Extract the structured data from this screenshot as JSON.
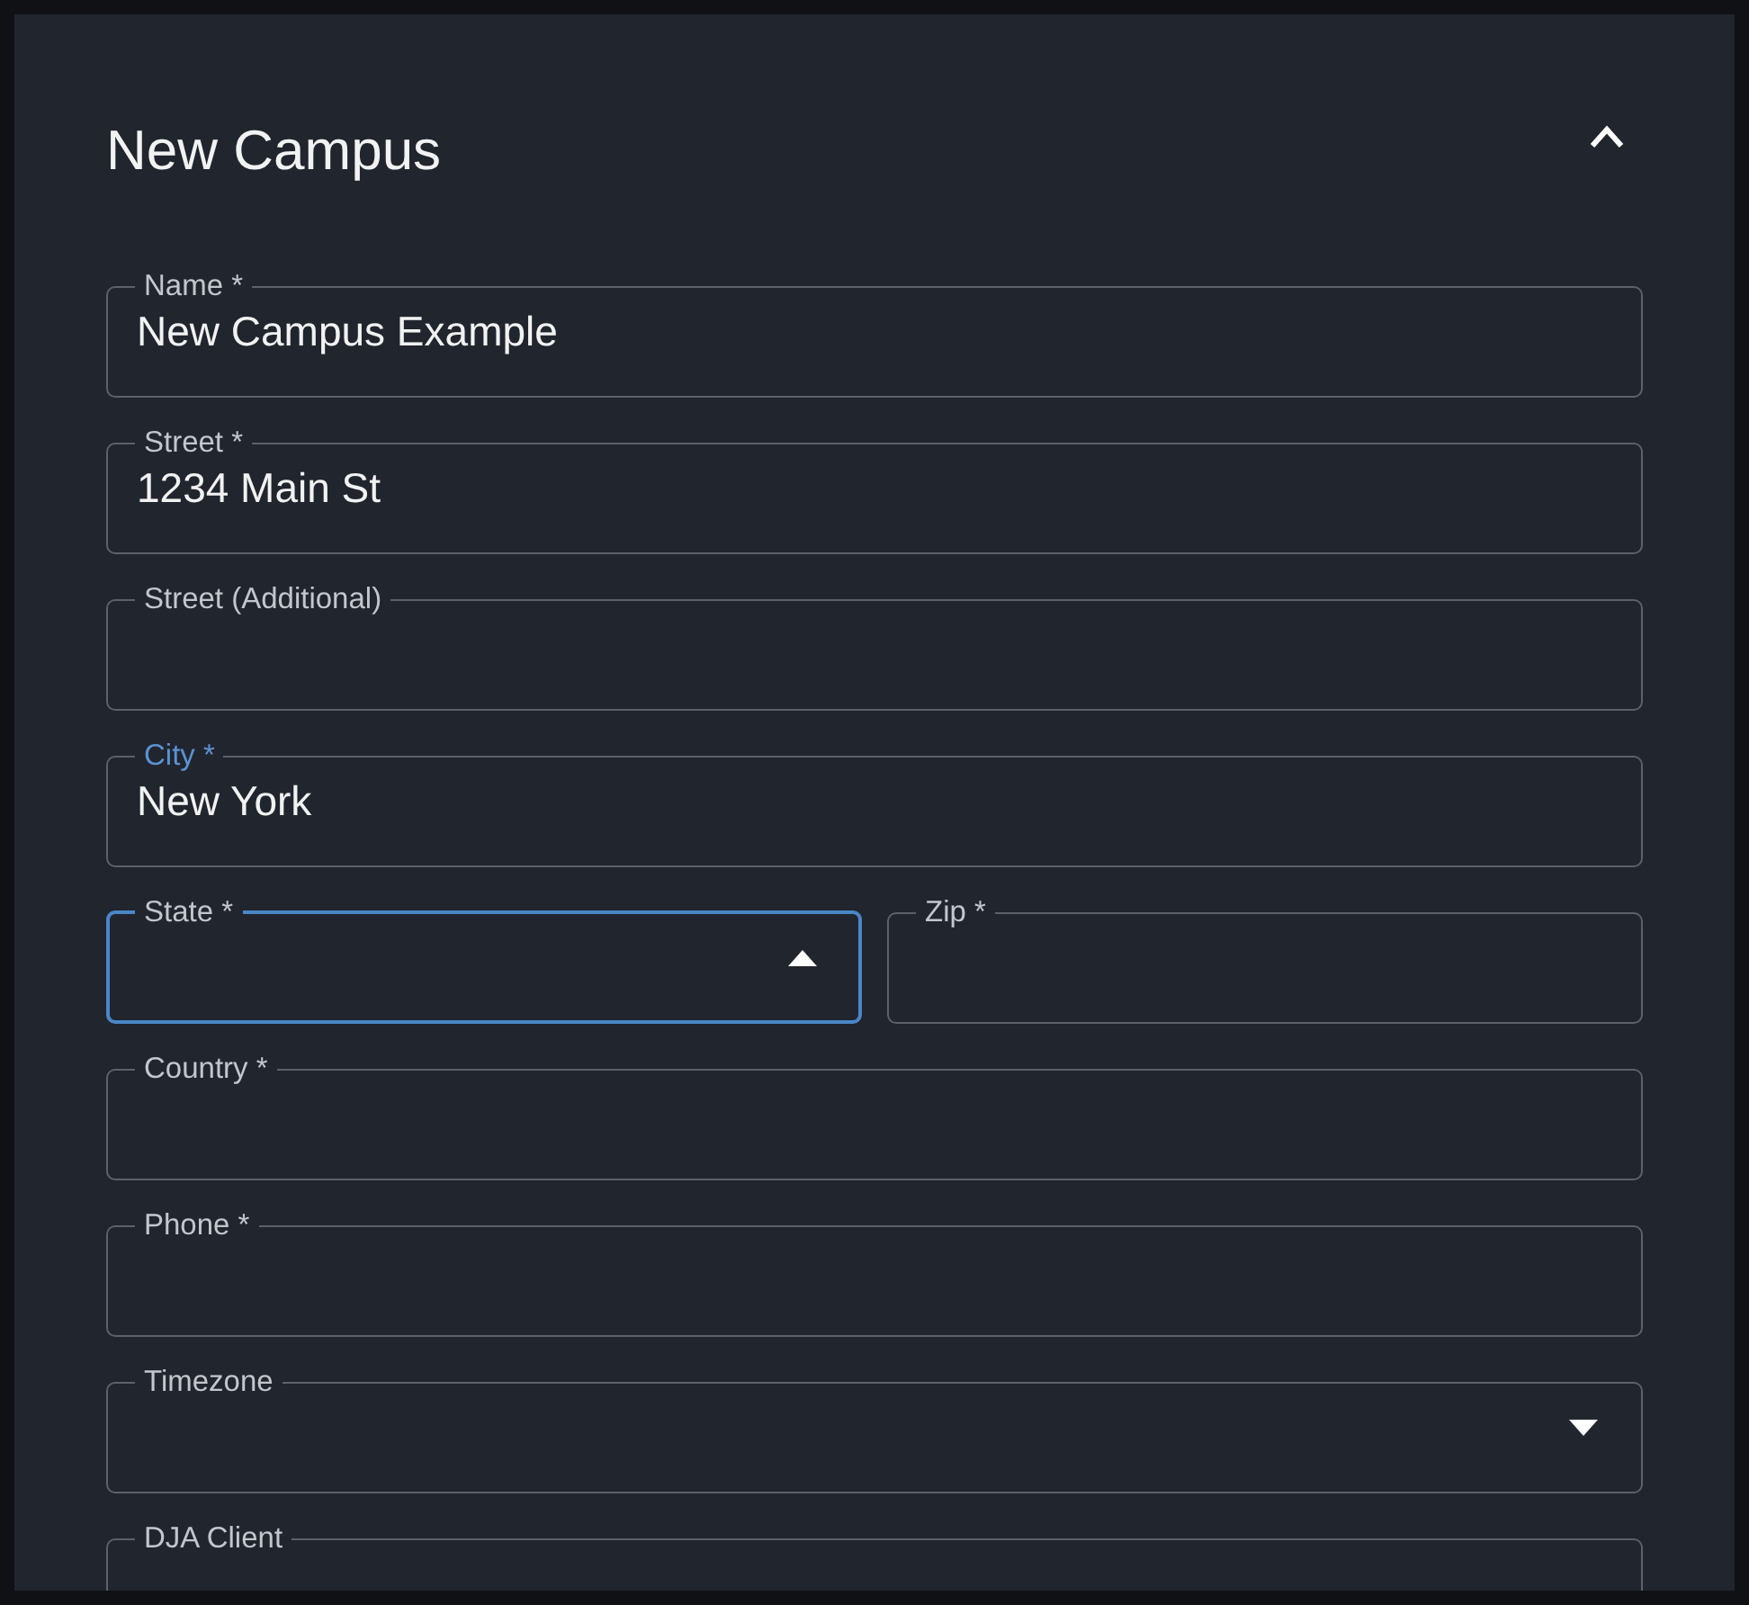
{
  "panel": {
    "title": "New Campus",
    "expanded": true
  },
  "rows": [
    [
      {
        "label": "Name *",
        "value": "New Campus Example",
        "kind": "text",
        "focused": false,
        "label_highlighted": false
      }
    ],
    [
      {
        "label": "Street *",
        "value": "1234 Main St",
        "kind": "text",
        "focused": false,
        "label_highlighted": false
      }
    ],
    [
      {
        "label": "Street (Additional)",
        "kind": "text",
        "focused": false,
        "label_highlighted": false
      }
    ],
    [
      {
        "label": "City *",
        "value": "New York",
        "kind": "text",
        "focused": false,
        "label_highlighted": true
      }
    ],
    [
      {
        "label": "State *",
        "kind": "select",
        "expanded": true,
        "focused": true,
        "label_highlighted": false
      },
      {
        "label": "Zip *",
        "kind": "text",
        "focused": false,
        "label_highlighted": false
      }
    ],
    [
      {
        "label": "Country *",
        "kind": "text",
        "focused": false,
        "label_highlighted": false
      }
    ],
    [
      {
        "label": "Phone *",
        "kind": "text",
        "focused": false,
        "label_highlighted": false
      }
    ],
    [
      {
        "label": "Timezone",
        "kind": "select",
        "expanded": false,
        "focused": false,
        "label_highlighted": false
      }
    ],
    [
      {
        "label": "DJA Client",
        "kind": "text",
        "focused": false,
        "label_highlighted": false
      }
    ]
  ]
}
